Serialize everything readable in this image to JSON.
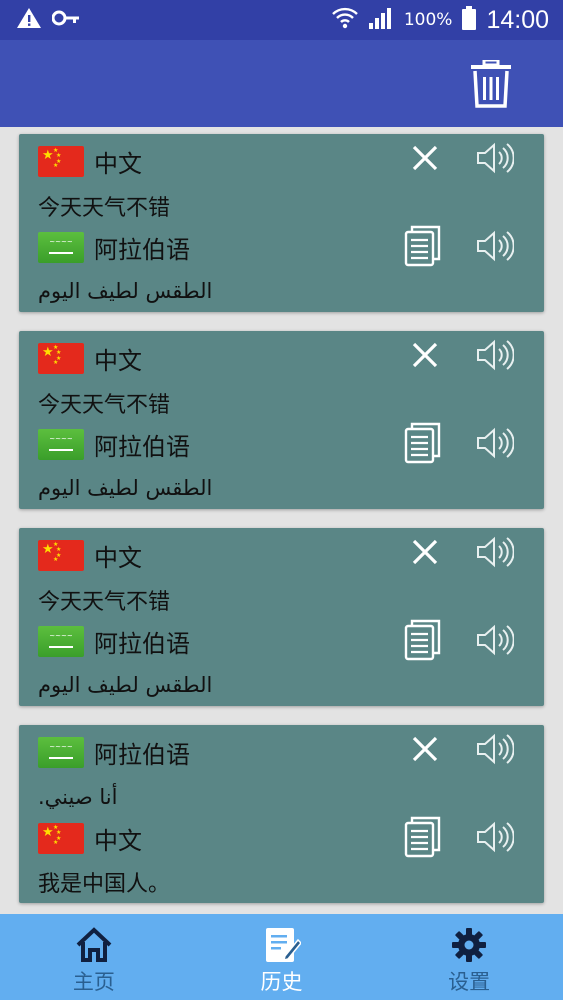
{
  "status_bar": {
    "battery_percent": "100%",
    "time": "14:00",
    "icons": [
      "warning-icon",
      "key-icon",
      "wifi-icon",
      "signal-icon",
      "battery-icon"
    ]
  },
  "app_bar": {
    "action_icon": "trash-icon"
  },
  "cards": [
    {
      "source_flag": "cn",
      "source_lang": "中文",
      "source_text": "今天天气不错",
      "target_flag": "sa",
      "target_lang": "阿拉伯语",
      "target_text": "الطقس لطيف اليوم"
    },
    {
      "source_flag": "cn",
      "source_lang": "中文",
      "source_text": "今天天气不错",
      "target_flag": "sa",
      "target_lang": "阿拉伯语",
      "target_text": "الطقس لطيف اليوم"
    },
    {
      "source_flag": "cn",
      "source_lang": "中文",
      "source_text": "今天天气不错",
      "target_flag": "sa",
      "target_lang": "阿拉伯语",
      "target_text": "الطقس لطيف اليوم"
    },
    {
      "source_flag": "sa",
      "source_lang": "阿拉伯语",
      "source_text": "أنا صيني.",
      "target_flag": "cn",
      "target_lang": "中文",
      "target_text": "我是中国人。"
    }
  ],
  "bottom_nav": {
    "home": "主页",
    "history": "历史",
    "settings": "设置",
    "active": "history"
  },
  "colors": {
    "status_bar": "#3240a6",
    "app_bar": "#3f51b5",
    "card": "#5a8686",
    "bottom_nav": "#62aef0",
    "background": "#e3e3e3"
  }
}
